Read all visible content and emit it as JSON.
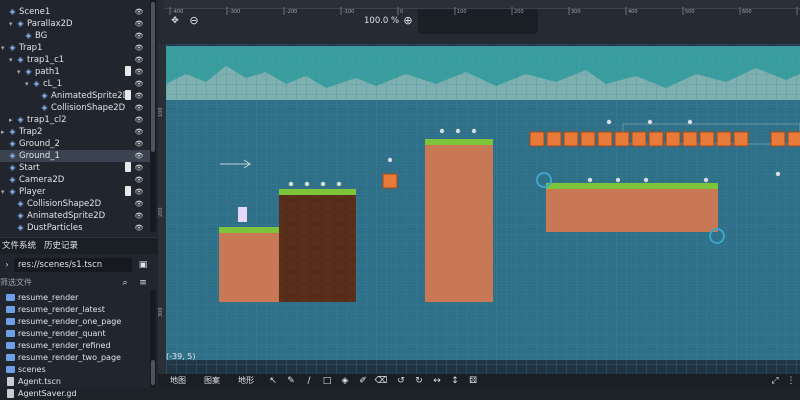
{
  "scene_tree": {
    "nodes": [
      {
        "label": "Scene1",
        "depth": 0,
        "icon": "node2d-icon",
        "arrow": "",
        "script": false,
        "selected": false
      },
      {
        "label": "Parallax2D",
        "depth": 1,
        "icon": "parallax-icon",
        "arrow": "▾",
        "script": false,
        "selected": false
      },
      {
        "label": "BG",
        "depth": 2,
        "icon": "sprite-icon",
        "arrow": "",
        "script": false,
        "selected": false
      },
      {
        "label": "Trap1",
        "depth": 0,
        "icon": "node-icon",
        "arrow": "▾",
        "script": false,
        "selected": false
      },
      {
        "label": "trap1_c1",
        "depth": 1,
        "icon": "path-icon",
        "arrow": "▾",
        "script": false,
        "selected": false
      },
      {
        "label": "path1",
        "depth": 2,
        "icon": "path-icon",
        "arrow": "▾",
        "script": true,
        "selected": false
      },
      {
        "label": "cL_1",
        "depth": 3,
        "icon": "area-icon",
        "arrow": "▾",
        "script": false,
        "selected": false
      },
      {
        "label": "AnimatedSprite2D",
        "depth": 4,
        "icon": "animated-sprite-icon",
        "arrow": "",
        "script": true,
        "selected": false
      },
      {
        "label": "CollisionShape2D",
        "depth": 4,
        "icon": "collision-shape-icon",
        "arrow": "",
        "script": false,
        "selected": false
      },
      {
        "label": "trap1_cl2",
        "depth": 1,
        "icon": "path-icon",
        "arrow": "▸",
        "script": false,
        "selected": false
      },
      {
        "label": "Trap2",
        "depth": 0,
        "icon": "node-icon",
        "arrow": "▸",
        "script": false,
        "selected": false
      },
      {
        "label": "Ground_2",
        "depth": 0,
        "icon": "tilemap-icon",
        "arrow": "",
        "script": false,
        "selected": false
      },
      {
        "label": "Ground_1",
        "depth": 0,
        "icon": "tilemap-icon",
        "arrow": "",
        "script": false,
        "selected": true
      },
      {
        "label": "Start",
        "depth": 0,
        "icon": "marker-icon",
        "arrow": "",
        "script": true,
        "selected": false
      },
      {
        "label": "Camera2D",
        "depth": 0,
        "icon": "camera-icon",
        "arrow": "",
        "script": false,
        "selected": false
      },
      {
        "label": "Player",
        "depth": 0,
        "icon": "body-icon",
        "arrow": "▾",
        "script": true,
        "selected": false
      },
      {
        "label": "CollisionShape2D",
        "depth": 1,
        "icon": "collision-shape-icon",
        "arrow": "",
        "script": false,
        "selected": false
      },
      {
        "label": "AnimatedSprite2D",
        "depth": 1,
        "icon": "animated-sprite-icon",
        "arrow": "",
        "script": false,
        "selected": false
      },
      {
        "label": "DustParticles",
        "depth": 1,
        "icon": "particles-icon",
        "arrow": "",
        "script": false,
        "selected": false
      }
    ]
  },
  "filesystem": {
    "tabs": [
      "文件系统",
      "历史记录"
    ],
    "path": "res://scenes/s1.tscn",
    "filter_placeholder": "筛选文件",
    "items": [
      {
        "label": "resume_render",
        "type": "folder"
      },
      {
        "label": "resume_render_latest",
        "type": "folder"
      },
      {
        "label": "resume_render_one_page",
        "type": "folder"
      },
      {
        "label": "resume_render_quant",
        "type": "folder"
      },
      {
        "label": "resume_render_refined",
        "type": "folder"
      },
      {
        "label": "resume_render_two_page",
        "type": "folder"
      },
      {
        "label": "scenes",
        "type": "folder"
      },
      {
        "label": "Agent.tscn",
        "type": "file"
      },
      {
        "label": "AgentSaver.gd",
        "type": "file"
      }
    ]
  },
  "viewport": {
    "zoom": "100.0 %",
    "cursor_coord": "(-39, 5)",
    "ruler_labels": [
      "-400",
      "-300",
      "-200",
      "-100",
      "0",
      "100",
      "200",
      "300",
      "400",
      "500",
      "600",
      "700"
    ],
    "ruler_left_labels": [
      "100",
      "200",
      "300"
    ],
    "colors": {
      "bg": "#223545",
      "grid": "#3a88a8",
      "dirt": "#c87855",
      "grass": "#7ec43a",
      "dark_dirt": "#5a301c",
      "block": "#e87a3a"
    }
  },
  "bottom_tabs": [
    "地图",
    "图案",
    "地形"
  ]
}
